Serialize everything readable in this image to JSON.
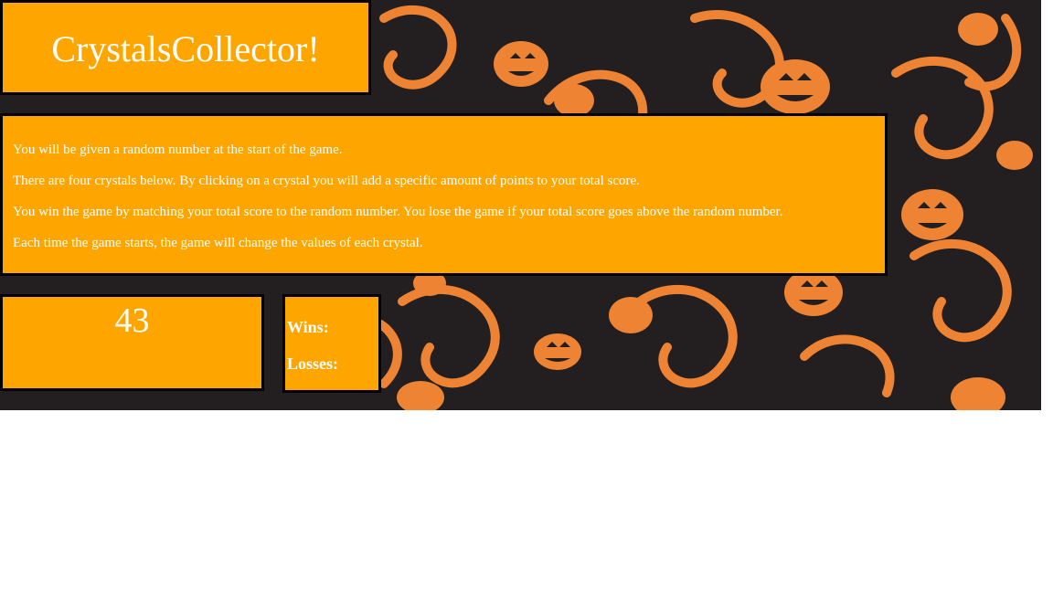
{
  "game": {
    "title": "CrystalsCollector!",
    "background_theme": "halloween-pumpkin-swirl",
    "colors": {
      "panel": "#ffa500",
      "border": "#000000",
      "text": "#ffffff",
      "bg_dark": "#231f20",
      "bg_pattern": "#ee8433"
    }
  },
  "instructions": [
    "You will be given a random number at the start of the game.",
    "There are four crystals below. By clicking on a crystal you will add a specific amount of points to your total score.",
    "You win the game by matching your total score to the random number. You lose the game if your total score goes above the random number.",
    "Each time the game starts, the game will change the values of each crystal."
  ],
  "target": {
    "random_number": "43"
  },
  "scoreboard": {
    "wins_label": "Wins:",
    "wins_value": "",
    "losses_label": "Losses:",
    "losses_value": ""
  }
}
